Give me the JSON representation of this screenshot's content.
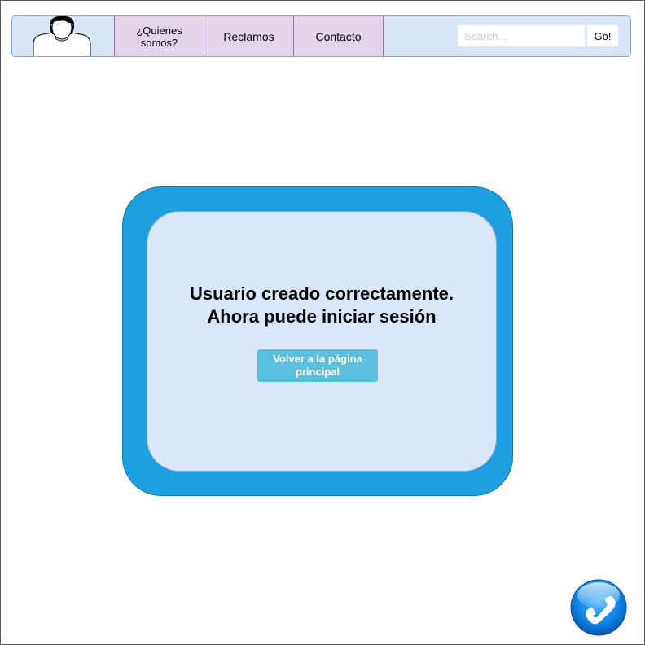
{
  "navbar": {
    "avatar_icon": "user-avatar-icon",
    "items": [
      {
        "line1": "¿Quienes",
        "line2": "somos?"
      },
      {
        "label": "Reclamos"
      },
      {
        "label": "Contacto"
      }
    ],
    "search": {
      "placeholder": "Search...",
      "value": "",
      "button_label": "Go!"
    }
  },
  "dialog": {
    "message_line1": "Usuario creado correctamente.",
    "message_line2": "Ahora puede iniciar sesión",
    "button_line1": "Volver a la página",
    "button_line2": "principal"
  },
  "phone": {
    "icon": "phone-icon"
  },
  "colors": {
    "navbar_bg": "#d8e6f8",
    "nav_item_bg": "#e1d5e7",
    "nav_item_border": "#9673a6",
    "dialog_outer": "#1ea0e0",
    "dialog_inner": "#dae7f9",
    "button_bg": "#5bc0de"
  }
}
